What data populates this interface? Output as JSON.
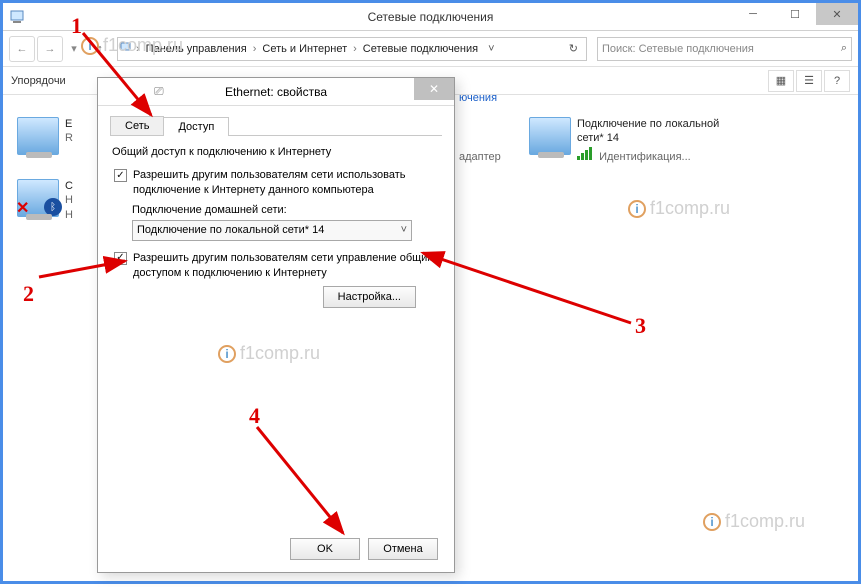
{
  "window": {
    "title": "Сетевые подключения",
    "breadcrumb": {
      "seg1": "Панель управления",
      "seg2": "Сеть и Интернет",
      "seg3": "Сетевые подключения"
    },
    "search_placeholder": "Поиск: Сетевые подключения",
    "sort_label": "Упорядочи"
  },
  "net_right_partial": "ючения",
  "adapter_partial": "адаптер",
  "net_item1": {
    "line1": "E",
    "line2": "R"
  },
  "net_item2": {
    "line1": "С",
    "line2": "Н",
    "line3": "Н"
  },
  "net_conn": {
    "title": "Подключение по локальной",
    "title2": "сети* 14",
    "status": "Идентификация..."
  },
  "dialog": {
    "title": "Ethernet: свойства",
    "tab_net": "Сеть",
    "tab_access": "Доступ",
    "group_title": "Общий доступ к подключению к Интернету",
    "chk1": "Разрешить другим пользователям сети использовать подключение к Интернету данного компьютера",
    "home_label": "Подключение домашней сети:",
    "combo_value": "Подключение по локальной сети* 14",
    "chk2": "Разрешить другим пользователям сети управление общим доступом к подключению к Интернету",
    "settings_btn": "Настройка...",
    "ok": "OK",
    "cancel": "Отмена"
  },
  "watermark": "f1comp.ru",
  "anno": {
    "n1": "1",
    "n2": "2",
    "n3": "3",
    "n4": "4"
  }
}
